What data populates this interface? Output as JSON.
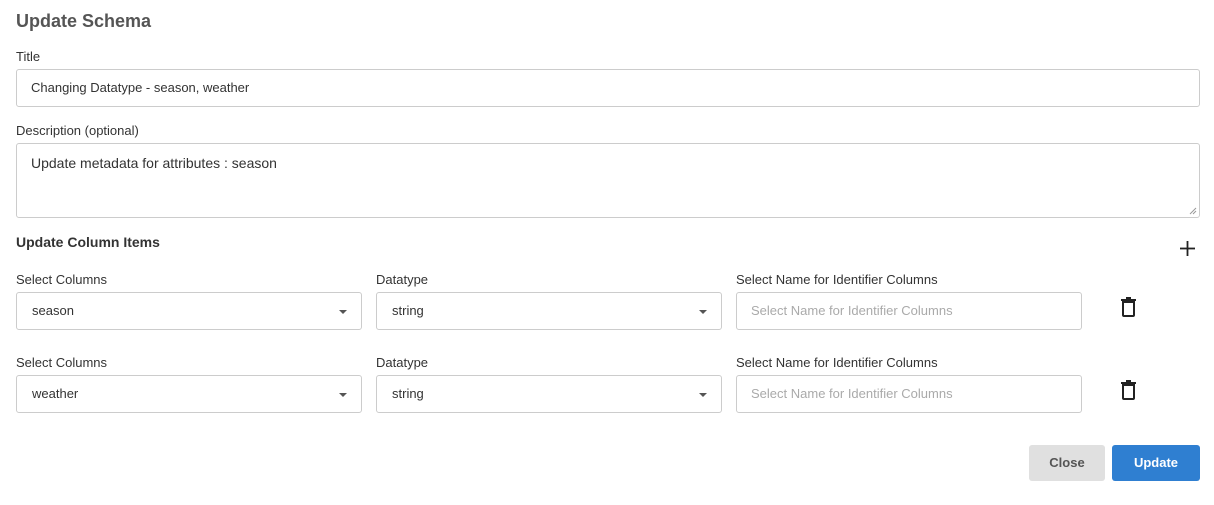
{
  "dialog": {
    "title": "Update Schema"
  },
  "form": {
    "title_label": "Title",
    "title_value": "Changing Datatype  - season, weather",
    "description_label": "Description (optional)",
    "description_value": "Update metadata for attributes : season"
  },
  "column_items": {
    "section_title": "Update Column Items",
    "add_icon": "plus-icon",
    "delete_icon": "trash-icon",
    "rows": [
      {
        "column_label": "Select Columns",
        "column_value": "season",
        "datatype_label": "Datatype",
        "datatype_value": "string",
        "identifier_label": "Select Name for Identifier Columns",
        "identifier_placeholder": "Select Name for Identifier Columns"
      },
      {
        "column_label": "Select Columns",
        "column_value": "weather",
        "datatype_label": "Datatype",
        "datatype_value": "string",
        "identifier_label": "Select Name for Identifier Columns",
        "identifier_placeholder": "Select Name for Identifier Columns"
      }
    ]
  },
  "actions": {
    "close_label": "Close",
    "update_label": "Update"
  },
  "colors": {
    "primary": "#2f7fd1",
    "secondary": "#e0e0e0",
    "border": "#cccccc"
  }
}
